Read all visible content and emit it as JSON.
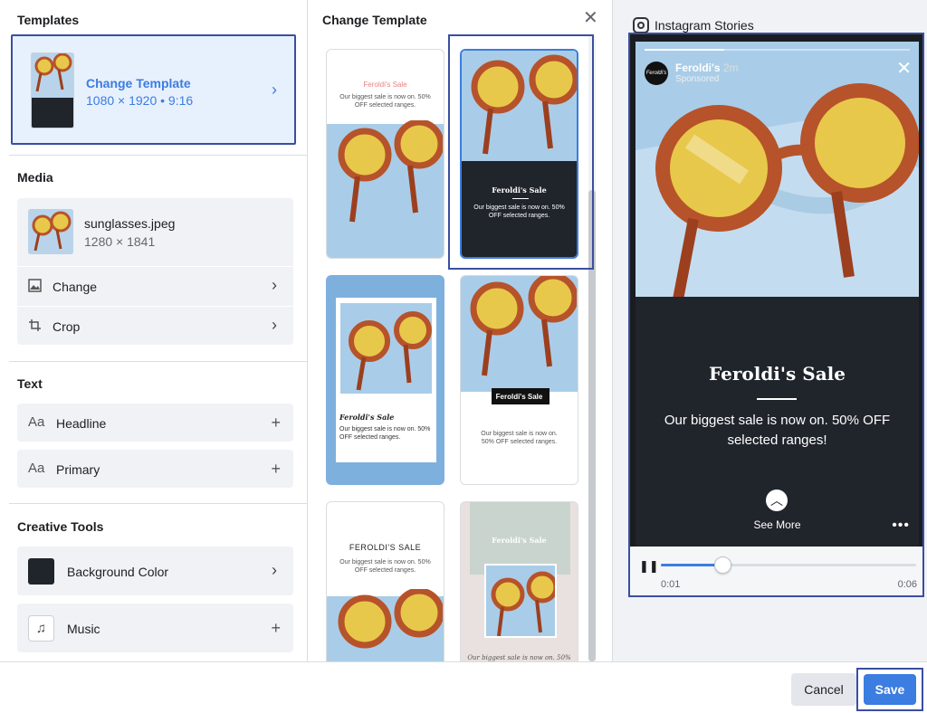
{
  "left": {
    "templates_title": "Templates",
    "template_card": {
      "title": "Change Template",
      "dims": "1080 × 1920 • 9:16"
    },
    "media_title": "Media",
    "media_file": {
      "name": "sunglasses.jpeg",
      "dims": "1280 × 1841"
    },
    "media_actions": [
      {
        "label": "Change"
      },
      {
        "label": "Crop"
      }
    ],
    "text_title": "Text",
    "text_items": [
      {
        "icon": "Aa",
        "label": "Headline"
      },
      {
        "icon": "Aa",
        "label": "Primary"
      }
    ],
    "creative_title": "Creative Tools",
    "creative_items": [
      {
        "label": "Background Color"
      },
      {
        "label": "Music"
      }
    ],
    "background_color": "#20242b"
  },
  "middle": {
    "title": "Change Template",
    "templates": [
      {
        "heading": "Feroldi's Sale",
        "body": "Our biggest sale is now on. 50% OFF selected ranges."
      },
      {
        "heading": "Feroldi's Sale",
        "body": "Our biggest sale is now on. 50% OFF selected ranges."
      },
      {
        "heading": "Feroldi's Sale",
        "body": "Our biggest sale is now on. 50% OFF selected ranges."
      },
      {
        "heading": "Feroldi's Sale",
        "body": "Our biggest sale is now on. 50% OFF selected ranges."
      },
      {
        "heading": "FEROLDI'S SALE",
        "body": "Our biggest sale is now on. 50% OFF selected ranges."
      },
      {
        "heading": "Feroldi's Sale",
        "body": "Our biggest sale is now on. 50%"
      }
    ]
  },
  "preview": {
    "platform": "Instagram Stories",
    "avatar_text": "Feroldi's",
    "account": "Feroldi's",
    "time": "2m",
    "sponsored": "Sponsored",
    "headline": "Feroldi's Sale",
    "body": "Our biggest sale is now on. 50% OFF selected ranges!",
    "cta": "See More",
    "progress": 0.24,
    "time_start": "0:01",
    "time_end": "0:06"
  },
  "footer": {
    "cancel": "Cancel",
    "save": "Save"
  },
  "colors": {
    "accent": "#3b7de0",
    "highlight_border": "#3a4fa0",
    "dark": "#20242b"
  }
}
